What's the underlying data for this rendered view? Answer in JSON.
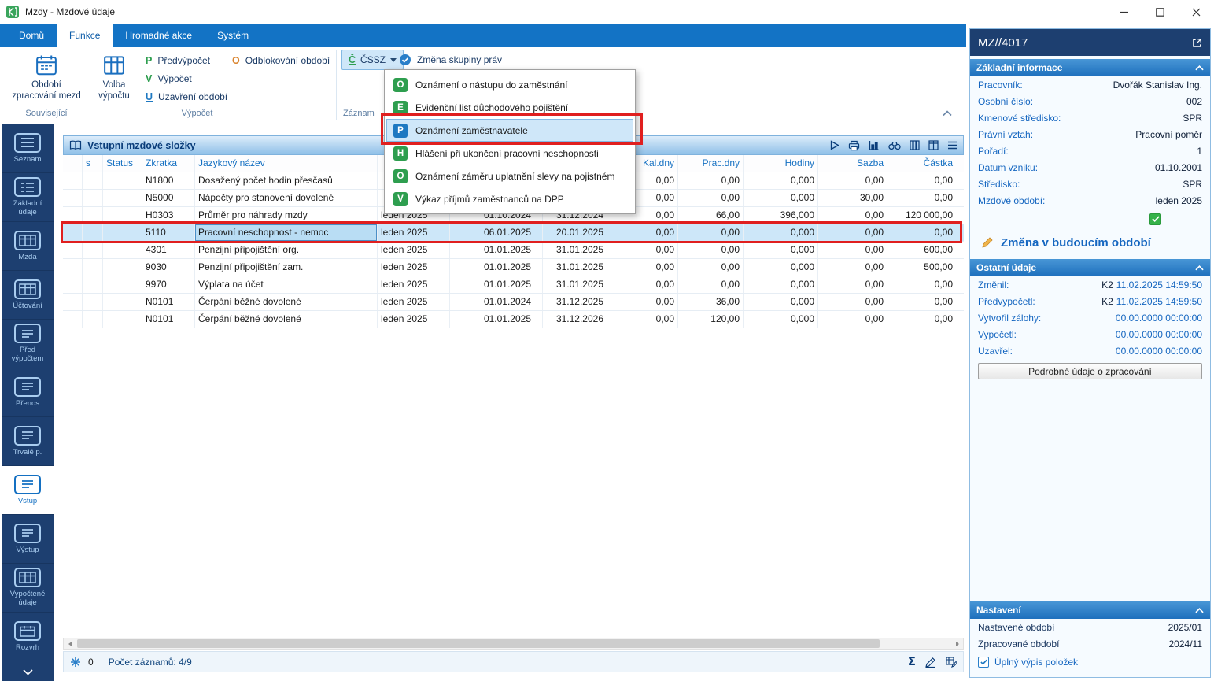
{
  "window": {
    "title": "Mzdy - Mzdové údaje"
  },
  "ribbon": {
    "tabs": [
      {
        "label": "Domů",
        "active": false
      },
      {
        "label": "Funkce",
        "active": true
      },
      {
        "label": "Hromadné akce",
        "active": false
      },
      {
        "label": "Systém",
        "active": false
      }
    ],
    "big_buttons": [
      {
        "label": "Období zpracování mezd"
      },
      {
        "label": "Volba výpočtu"
      }
    ],
    "small_buttons": [
      {
        "letter": "P",
        "color": "#2e9e4f",
        "label": "Předvýpočet"
      },
      {
        "letter": "V",
        "color": "#2e9e4f",
        "label": "Výpočet"
      },
      {
        "letter": "U",
        "color": "#1d78c1",
        "label": "Uzavření období"
      }
    ],
    "odblokovani": {
      "letter": "O",
      "color": "#d9822b",
      "label": "Odblokování období"
    },
    "cssz": {
      "letter": "Č",
      "color": "#2e9e4f",
      "label": "ČSSZ"
    },
    "rights": {
      "label": "Změna skupiny práv"
    },
    "group_labels": {
      "souvisejici": "Související",
      "vypocet": "Výpočet",
      "zaznam": "Záznam"
    }
  },
  "cssz_menu": {
    "items": [
      {
        "letter": "O",
        "color": "#2e9e4f",
        "label": "Oznámení o nástupu do zaměstnání",
        "highlighted": false
      },
      {
        "letter": "E",
        "color": "#2e9e4f",
        "label": "Evidenční list důchodového pojištění",
        "highlighted": false
      },
      {
        "letter": "P",
        "color": "#1d78c1",
        "label": "Oznámení zaměstnavatele",
        "highlighted": true
      },
      {
        "letter": "H",
        "color": "#2e9e4f",
        "label": "Hlášení při ukončení pracovní neschopnosti",
        "highlighted": false
      },
      {
        "letter": "O",
        "color": "#2e9e4f",
        "label": "Oznámení záměru uplatnění slevy na pojistném",
        "highlighted": false
      },
      {
        "letter": "V",
        "color": "#2e9e4f",
        "label": "Výkaz příjmů zaměstnanců na DPP",
        "highlighted": false
      }
    ]
  },
  "sidebar": {
    "items": [
      {
        "label": "Seznam",
        "icon": "list",
        "active": false
      },
      {
        "label": "Základní údaje",
        "icon": "detail",
        "active": false
      },
      {
        "label": "Mzda",
        "icon": "table",
        "active": false
      },
      {
        "label": "Účtování",
        "icon": "table",
        "active": false
      },
      {
        "label": "Před výpočtem",
        "icon": "doc",
        "active": false
      },
      {
        "label": "Přenos",
        "icon": "doc",
        "active": false
      },
      {
        "label": "Trvalé p.",
        "icon": "doc",
        "active": false
      },
      {
        "label": "Vstup",
        "icon": "doc",
        "active": true
      },
      {
        "label": "Výstup",
        "icon": "doc",
        "active": false
      },
      {
        "label": "Vypočtené údaje",
        "icon": "table",
        "active": false
      },
      {
        "label": "Rozvrh",
        "icon": "calendar",
        "active": false
      }
    ]
  },
  "grid": {
    "title": "Vstupní mzdové složky",
    "columns": [
      "",
      "s",
      "Status",
      "Zkratka",
      "Jazykový název",
      "",
      "",
      "",
      "Kal.dny",
      "Prac.dny",
      "Hodiny",
      "Sazba",
      "Částka"
    ],
    "rows": [
      {
        "zkratka": "N1800",
        "nazev": "Dosažený počet hodin přesčasů",
        "obdobi": "",
        "od": "",
        "do": "",
        "kal": "0,00",
        "prac": "0,00",
        "hod": "0,000",
        "sazba": "0,00",
        "castka": "0,00",
        "selected": false
      },
      {
        "zkratka": "N5000",
        "nazev": "Nápočty pro stanovení dovolené",
        "obdobi": "",
        "od": "",
        "do": "",
        "kal": "0,00",
        "prac": "0,00",
        "hod": "0,000",
        "sazba": "30,00",
        "castka": "0,00",
        "selected": false
      },
      {
        "zkratka": "H0303",
        "nazev": "Průměr pro náhrady mzdy",
        "obdobi": "leden 2025",
        "od": "01.10.2024",
        "do": "31.12.2024",
        "kal": "0,00",
        "prac": "66,00",
        "hod": "396,000",
        "sazba": "0,00",
        "castka": "120 000,00",
        "selected": false
      },
      {
        "zkratka": "5110",
        "nazev": "Pracovní neschopnost - nemoc",
        "obdobi": "leden 2025",
        "od": "06.01.2025",
        "do": "20.01.2025",
        "kal": "0,00",
        "prac": "0,00",
        "hod": "0,000",
        "sazba": "0,00",
        "castka": "0,00",
        "selected": true
      },
      {
        "zkratka": "4301",
        "nazev": "Penzijní připojištění org.",
        "obdobi": "leden 2025",
        "od": "01.01.2025",
        "do": "31.01.2025",
        "kal": "0,00",
        "prac": "0,00",
        "hod": "0,000",
        "sazba": "0,00",
        "castka": "600,00",
        "selected": false
      },
      {
        "zkratka": "9030",
        "nazev": "Penzijní připojištění zam.",
        "obdobi": "leden 2025",
        "od": "01.01.2025",
        "do": "31.01.2025",
        "kal": "0,00",
        "prac": "0,00",
        "hod": "0,000",
        "sazba": "0,00",
        "castka": "500,00",
        "selected": false
      },
      {
        "zkratka": "9970",
        "nazev": "Výplata na účet",
        "obdobi": "leden 2025",
        "od": "01.01.2025",
        "do": "31.01.2025",
        "kal": "0,00",
        "prac": "0,00",
        "hod": "0,000",
        "sazba": "0,00",
        "castka": "0,00",
        "selected": false
      },
      {
        "zkratka": "N0101",
        "nazev": "Čerpání běžné dovolené",
        "obdobi": "leden 2025",
        "od": "01.01.2024",
        "do": "31.12.2025",
        "kal": "0,00",
        "prac": "36,00",
        "hod": "0,000",
        "sazba": "0,00",
        "castka": "0,00",
        "selected": false
      },
      {
        "zkratka": "N0101",
        "nazev": "Čerpání běžné dovolené",
        "obdobi": "leden 2025",
        "od": "01.01.2025",
        "do": "31.12.2026",
        "kal": "0,00",
        "prac": "120,00",
        "hod": "0,000",
        "sazba": "0,00",
        "castka": "0,00",
        "selected": false
      }
    ]
  },
  "status_bar": {
    "counter": "0",
    "records": "Počet záznamů: 4/9"
  },
  "right_panel": {
    "id": "MZ//4017",
    "basic_info": {
      "header": "Základní informace",
      "fields": [
        {
          "label": "Pracovník:",
          "value": "Dvořák Stanislav Ing."
        },
        {
          "label": "Osobní číslo:",
          "value": "002"
        },
        {
          "label": "Kmenové středisko:",
          "value": "SPR"
        },
        {
          "label": "Právní vztah:",
          "value": "Pracovní poměr"
        },
        {
          "label": "Pořadí:",
          "value": "1"
        },
        {
          "label": "Datum vzniku:",
          "value": "01.10.2001"
        },
        {
          "label": "Středisko:",
          "value": "SPR"
        },
        {
          "label": "Mzdové období:",
          "value": "leden 2025"
        }
      ],
      "change_action": "Změna v budoucím období"
    },
    "other_info": {
      "header": "Ostatní údaje",
      "fields": [
        {
          "label": "Změnil:",
          "prefix": "K2",
          "time": "11.02.2025 14:59:50"
        },
        {
          "label": "Předvypočetl:",
          "prefix": "K2",
          "time": "11.02.2025 14:59:50"
        },
        {
          "label": "Vytvořil zálohy:",
          "prefix": "",
          "time": "00.00.0000 00:00:00"
        },
        {
          "label": "Vypočetl:",
          "prefix": "",
          "time": "00.00.0000 00:00:00"
        },
        {
          "label": "Uzavřel:",
          "prefix": "",
          "time": "00.00.0000 00:00:00"
        }
      ],
      "details_button": "Podrobné údaje o zpracování"
    },
    "settings": {
      "header": "Nastavení",
      "fields": [
        {
          "label": "Nastavené období",
          "value": "2025/01"
        },
        {
          "label": "Zpracované období",
          "value": "2024/11"
        }
      ],
      "checkbox_label": "Úplný výpis položek"
    }
  },
  "colors": {
    "accent": "#1373c5",
    "selection": "#cde7f9",
    "annotation": "#e01f1f",
    "green_check": "#36b24a"
  }
}
